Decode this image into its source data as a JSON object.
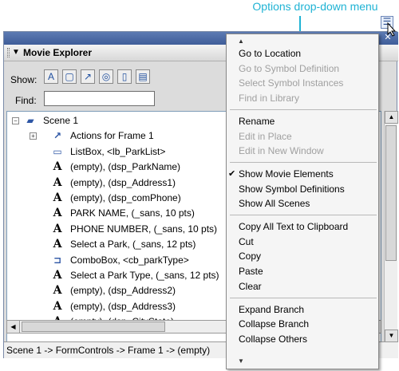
{
  "callout": {
    "text": "Options drop-down menu"
  },
  "panel": {
    "title": "Movie Explorer",
    "show_label": "Show:",
    "find_label": "Find:",
    "find_value": "",
    "status_path": "Scene 1 -> FormControls -> Frame 1 -> (empty)"
  },
  "show_buttons": [
    {
      "name": "show-text-button",
      "glyph": "A"
    },
    {
      "name": "show-buttons-button",
      "glyph": "▢"
    },
    {
      "name": "show-actionscripts-button",
      "glyph": "↗"
    },
    {
      "name": "show-video-sounds-button",
      "glyph": "◎"
    },
    {
      "name": "show-frames-layers-button",
      "glyph": "▯"
    },
    {
      "name": "customize-items-button",
      "glyph": "▤"
    }
  ],
  "tree": {
    "rows": [
      {
        "text": "Scene 1",
        "icon": "scene-icon",
        "glyph": "▰",
        "level": 0,
        "expander": "minus"
      },
      {
        "text": "Actions for Frame 1",
        "icon": "actions-icon",
        "glyph": "↗",
        "level": 1,
        "expander": "plus"
      },
      {
        "text": "ListBox, <lb_ParkList>",
        "icon": "component-icon",
        "glyph": "▭",
        "level": 1
      },
      {
        "text": "(empty), (dsp_ParkName)",
        "icon": "text-icon",
        "glyph": "A",
        "level": 1
      },
      {
        "text": "(empty), (dsp_Address1)",
        "icon": "text-icon",
        "glyph": "A",
        "level": 1
      },
      {
        "text": "(empty), (dsp_comPhone)",
        "icon": "text-icon",
        "glyph": "A",
        "level": 1
      },
      {
        "text": "PARK NAME, (_sans, 10 pts)",
        "icon": "text-icon",
        "glyph": "A",
        "level": 1
      },
      {
        "text": "PHONE NUMBER, (_sans, 10 pts)",
        "icon": "text-icon",
        "glyph": "A",
        "level": 1
      },
      {
        "text": "Select a Park, (_sans, 12 pts)",
        "icon": "text-icon",
        "glyph": "A",
        "level": 1
      },
      {
        "text": "ComboBox, <cb_parkType>",
        "icon": "component-icon",
        "glyph": "⊐",
        "level": 1
      },
      {
        "text": "Select a Park Type, (_sans, 12 pts)",
        "icon": "text-icon",
        "glyph": "A",
        "level": 1
      },
      {
        "text": "(empty), (dsp_Address2)",
        "icon": "text-icon",
        "glyph": "A",
        "level": 1
      },
      {
        "text": "(empty), (dsp_Address3)",
        "icon": "text-icon",
        "glyph": "A",
        "level": 1
      },
      {
        "text": "(empty), (dsp_CityState)",
        "icon": "text-icon",
        "glyph": "A",
        "level": 1
      }
    ]
  },
  "menu": {
    "groups": [
      [
        {
          "label": "Go to Location",
          "enabled": true
        },
        {
          "label": "Go to Symbol Definition",
          "enabled": false
        },
        {
          "label": "Select Symbol Instances",
          "enabled": false
        },
        {
          "label": "Find in Library",
          "enabled": false
        }
      ],
      [
        {
          "label": "Rename",
          "enabled": true
        },
        {
          "label": "Edit in Place",
          "enabled": false
        },
        {
          "label": "Edit in New Window",
          "enabled": false
        }
      ],
      [
        {
          "label": "Show Movie Elements",
          "enabled": true,
          "checked": true
        },
        {
          "label": "Show Symbol Definitions",
          "enabled": true
        },
        {
          "label": "Show All Scenes",
          "enabled": true
        }
      ],
      [
        {
          "label": "Copy All Text to Clipboard",
          "enabled": true
        },
        {
          "label": "Cut",
          "enabled": true
        },
        {
          "label": "Copy",
          "enabled": true
        },
        {
          "label": "Paste",
          "enabled": true
        },
        {
          "label": "Clear",
          "enabled": true
        }
      ],
      [
        {
          "label": "Expand Branch",
          "enabled": true
        },
        {
          "label": "Collapse Branch",
          "enabled": true
        },
        {
          "label": "Collapse Others",
          "enabled": true
        }
      ]
    ]
  },
  "colors": {
    "callout": "#1fb3d4",
    "titlebar": "#4a68a5",
    "disabled_text": "#a0a0a0"
  }
}
